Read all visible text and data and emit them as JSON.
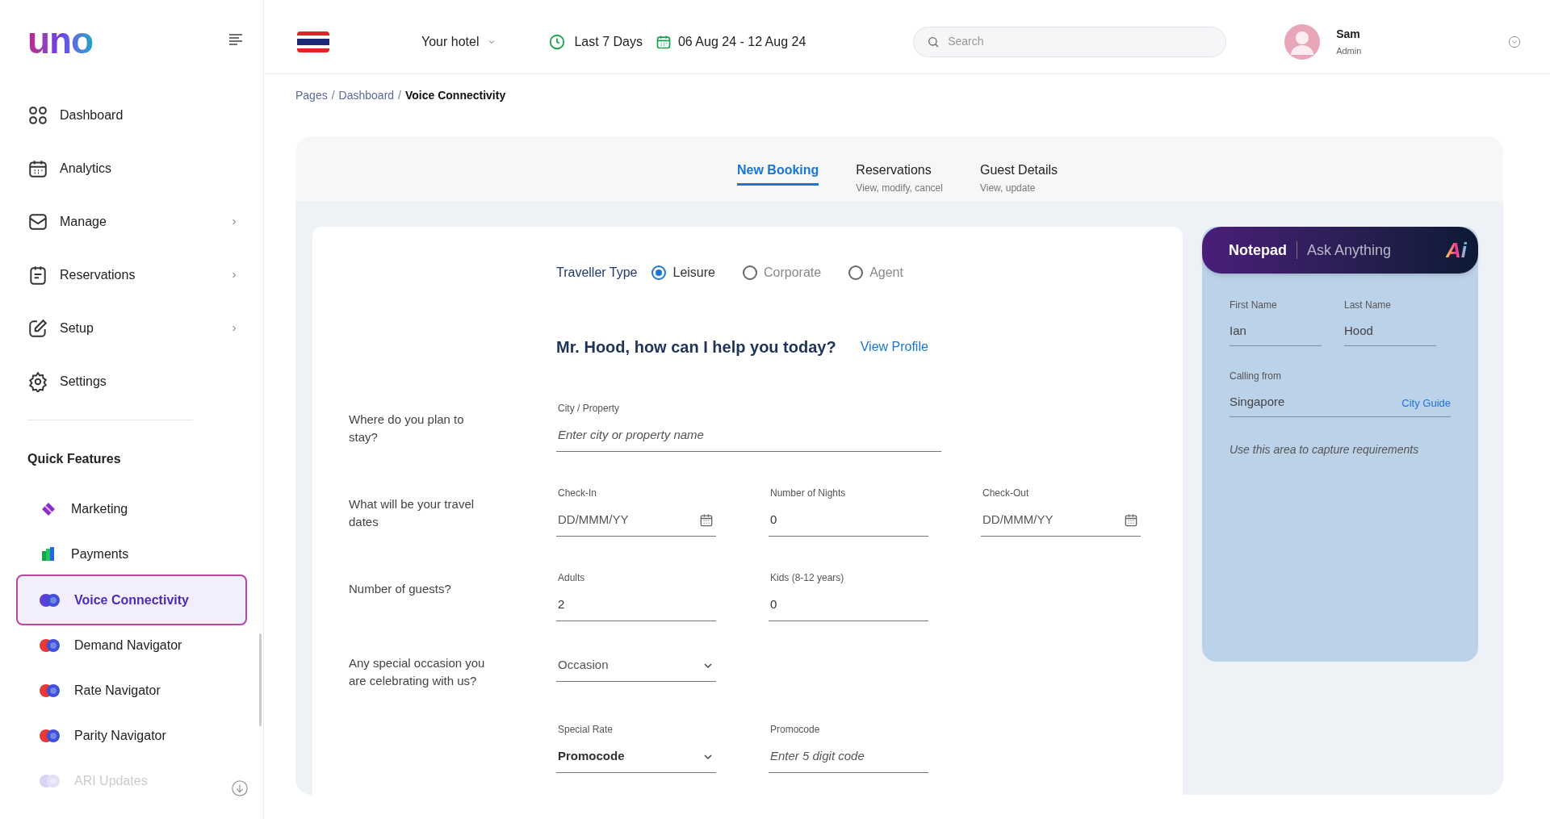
{
  "sidebar": {
    "logo": "uno",
    "nav": [
      {
        "label": "Dashboard",
        "kind": "link"
      },
      {
        "label": "Analytics",
        "kind": "link"
      },
      {
        "label": "Manage",
        "kind": "submenu"
      },
      {
        "label": "Reservations",
        "kind": "submenu"
      },
      {
        "label": "Setup",
        "kind": "submenu"
      },
      {
        "label": "Settings",
        "kind": "link"
      }
    ],
    "quick_title": "Quick Features",
    "quick": [
      {
        "label": "Marketing",
        "kind": "diamond",
        "color": "#8b2fc9",
        "selected": false,
        "disabled": false
      },
      {
        "label": "Payments",
        "kind": "bars",
        "color": "#16a34a",
        "selected": false,
        "disabled": false
      },
      {
        "label": "Voice Connectivity",
        "kind": "circles",
        "color": "#5b3fd6",
        "selected": true,
        "disabled": false
      },
      {
        "label": "Demand Navigator",
        "kind": "circles",
        "color": "#e53935",
        "selected": false,
        "disabled": false
      },
      {
        "label": "Rate Navigator",
        "kind": "circles",
        "color": "#e53935",
        "selected": false,
        "disabled": false
      },
      {
        "label": "Parity Navigator",
        "kind": "circles",
        "color": "#e53935",
        "selected": false,
        "disabled": false
      },
      {
        "label": "ARI Updates",
        "kind": "circles",
        "color": "#d9d3f5",
        "selected": false,
        "disabled": true
      }
    ]
  },
  "header": {
    "hotel": "Your hotel",
    "period": "Last 7 Days",
    "dates": "06 Aug 24 - 12 Aug 24",
    "search": {
      "placeholder": "Search"
    },
    "user": {
      "name": "Sam",
      "role": "Admin"
    }
  },
  "breadcrumb": [
    {
      "kind": "link",
      "label": "Pages"
    },
    {
      "kind": "separator",
      "label": "/"
    },
    {
      "kind": "link",
      "label": "Dashboard"
    },
    {
      "kind": "separator",
      "label": "/"
    },
    {
      "kind": "current",
      "label": "Voice Connectivity"
    }
  ],
  "tabs": [
    {
      "label": "New Booking",
      "selected": true
    },
    {
      "label": "Reservations",
      "sub": "View, modify, cancel",
      "selected": false
    },
    {
      "label": "Guest Details",
      "sub": "View, update",
      "selected": false
    }
  ],
  "form": {
    "traveller_label": "Traveller Type",
    "traveller_types": [
      {
        "label": "Leisure",
        "selected": true
      },
      {
        "label": "Corporate",
        "selected": false
      },
      {
        "label": "Agent",
        "selected": false
      }
    ],
    "greeting": "Mr. Hood, how can I help you today?",
    "profile_link": "View Profile",
    "rows": [
      {
        "question": "Where do you plan to stay?",
        "fields": [
          {
            "kind": "text",
            "label": "City / Property",
            "placeholder": "Enter city or property name"
          }
        ]
      },
      {
        "question": "What will be your travel dates",
        "fields": [
          {
            "kind": "date",
            "label": "Check-In",
            "placeholder": "DD/MMM/YY"
          },
          {
            "kind": "text",
            "label": "Number of Nights",
            "value": "0"
          },
          {
            "kind": "date",
            "label": "Check-Out",
            "placeholder": "DD/MMM/YY"
          }
        ]
      },
      {
        "question": "Number of guests?",
        "fields": [
          {
            "kind": "text",
            "label": "Adults",
            "value": "2"
          },
          {
            "kind": "text",
            "label": "Kids (8-12 years)",
            "value": "0"
          }
        ]
      },
      {
        "question": "Any special occasion you are celebrating with us?",
        "fields": [
          {
            "kind": "select",
            "placeholder": "Occasion"
          }
        ]
      },
      {
        "fields": [
          {
            "kind": "select",
            "label": "Special Rate",
            "value": "Promocode"
          },
          {
            "kind": "text",
            "label": "Promocode",
            "placeholder": "Enter 5 digit code"
          }
        ]
      }
    ]
  },
  "notepad": {
    "tabs": [
      {
        "label": "Notepad",
        "selected": true
      },
      {
        "label": "Ask Anything",
        "selected": false
      }
    ],
    "ai_logo": "Ai",
    "first_name": {
      "label": "First Name",
      "value": "Ian"
    },
    "last_name": {
      "label": "Last Name",
      "value": "Hood"
    },
    "calling_from": {
      "label": "Calling from",
      "value": "Singapore",
      "link": "City Guide"
    },
    "notes": {
      "placeholder": "Use this area to capture requirements"
    }
  }
}
